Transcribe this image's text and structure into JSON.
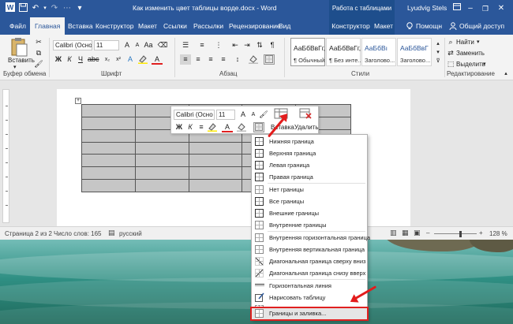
{
  "titlebar": {
    "doc_title": "Как изменить цвет таблицы ворде.docx - Word",
    "context_title": "Работа с таблицами",
    "user": "Lyudvig Stels",
    "minimize": "–",
    "restore": "❐",
    "close": "✕"
  },
  "tabs": [
    {
      "label": "Файл"
    },
    {
      "label": "Главная"
    },
    {
      "label": "Вставка"
    },
    {
      "label": "Конструктор"
    },
    {
      "label": "Макет"
    },
    {
      "label": "Ссылки"
    },
    {
      "label": "Рассылки"
    },
    {
      "label": "Рецензирование"
    },
    {
      "label": "Вид"
    },
    {
      "label": "Конструктор"
    },
    {
      "label": "Макет"
    },
    {
      "label": "Помощн"
    },
    {
      "label": "Общий доступ"
    }
  ],
  "ribbon": {
    "paste_label": "Вставить",
    "font_name": "Calibri (Осно",
    "font_size": "11",
    "bold": "Ж",
    "italic": "К",
    "underline": "Ч",
    "font_color_letter": "А",
    "grow_font": "A",
    "shrink_font": "A",
    "styles": [
      {
        "sample": "АаБбВвГг,",
        "name": "¶ Обычный"
      },
      {
        "sample": "АаБбВвГг,",
        "name": "¶ Без инте..."
      },
      {
        "sample": "АаБбВı",
        "name": "Заголово..."
      },
      {
        "sample": "АаБбВвГ",
        "name": "Заголово..."
      }
    ],
    "find": "Найти",
    "replace": "Заменить",
    "select": "Выделить",
    "groups": {
      "clipboard": "Буфер обмена",
      "font": "Шрифт",
      "paragraph": "Абзац",
      "styles": "Стили",
      "editing": "Редактирование"
    }
  },
  "mini_toolbar": {
    "font_name": "Calibri (Осно",
    "font_size": "11",
    "bold": "Ж",
    "italic": "К",
    "font_color_letter": "А",
    "insert_label": "Вставка",
    "delete_label": "Удалить"
  },
  "dropdown": {
    "items": [
      "Нижняя граница",
      "Верхняя граница",
      "Левая граница",
      "Правая граница",
      "Нет границы",
      "Все границы",
      "Внешние границы",
      "Внутренние границы",
      "Внутренняя горизонтальная граница",
      "Внутренняя вертикальная граница",
      "Диагональная граница сверху вниз",
      "Диагональная граница снизу вверх",
      "Горизонтальная линия",
      "Нарисовать таблицу",
      "Отобразить сетку",
      "Границы и заливка..."
    ]
  },
  "statusbar": {
    "page": "Страница 2 из 2",
    "words": "Число слов: 165",
    "language": "русский",
    "zoom": "128 %"
  },
  "colors": {
    "word_blue": "#2b579a",
    "ribbon_bg": "#f3f3f3",
    "table_fill": "#c6c6c6",
    "highlight_red": "#e31c1c"
  }
}
